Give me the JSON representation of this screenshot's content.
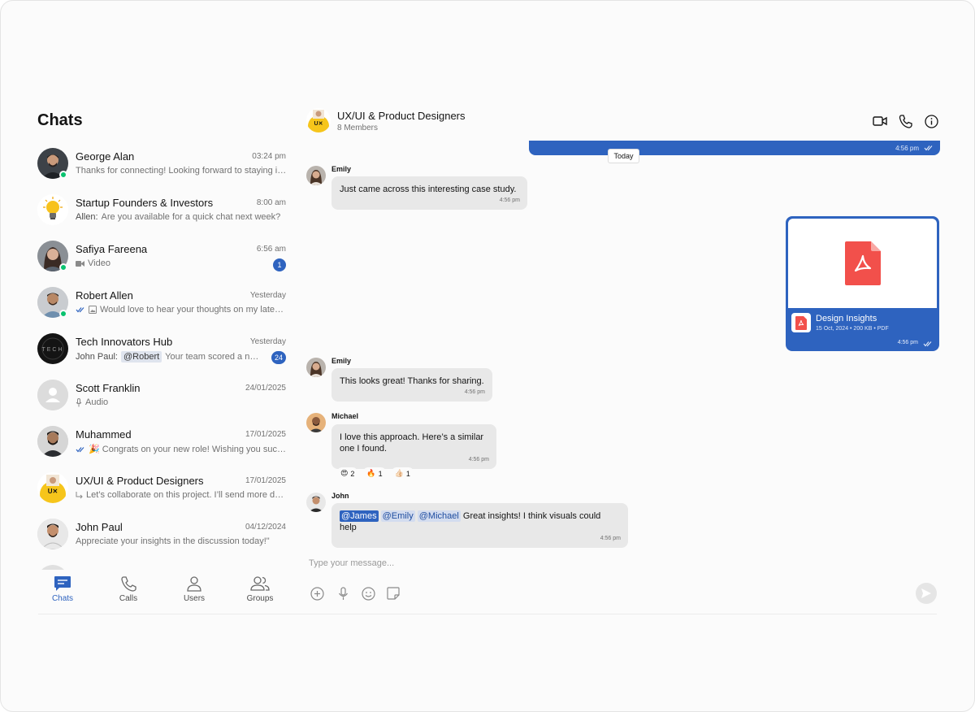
{
  "sidebar": {
    "title": "Chats",
    "chats": [
      {
        "name": "George Alan",
        "time": "03:24 pm",
        "sender": "",
        "preview": "Thanks for connecting! Looking forward to staying in touch.",
        "unread": "",
        "online": true
      },
      {
        "name": "Startup Founders & Investors",
        "time": "8:00 am",
        "sender": "Allen:",
        "preview": "Are you available for a quick chat next week?",
        "unread": "",
        "online": false
      },
      {
        "name": "Safiya Fareena",
        "time": "6:56 am",
        "sender": "",
        "preview": "Video",
        "unread": "1",
        "online": true
      },
      {
        "name": "Robert Allen",
        "time": "Yesterday",
        "sender": "",
        "preview": "Would love to hear your thoughts on my latest post",
        "unread": "",
        "online": true
      },
      {
        "name": "Tech Innovators Hub",
        "time": "Yesterday",
        "sender": "John Paul:",
        "mention": "@Robert",
        "preview": "Your team scored a new milestone",
        "unread": "24",
        "online": false
      },
      {
        "name": "Scott Franklin",
        "time": "24/01/2025",
        "sender": "",
        "preview": "Audio",
        "unread": "",
        "online": false
      },
      {
        "name": "Muhammed",
        "time": "17/01/2025",
        "sender": "",
        "preview": "🎉 Congrats on your new role! Wishing you success",
        "unread": "",
        "online": false
      },
      {
        "name": "UX/UI & Product Designers",
        "time": "17/01/2025",
        "sender": "",
        "preview": "Let’s collaborate on this project. I’ll send more details",
        "unread": "",
        "online": false
      },
      {
        "name": "John Paul",
        "time": "04/12/2024",
        "sender": "",
        "preview": "Appreciate your insights in the discussion today!\"",
        "unread": "",
        "online": false
      }
    ]
  },
  "nav": [
    {
      "label": "Chats",
      "icon": "chat-bubble-icon",
      "active": true
    },
    {
      "label": "Calls",
      "icon": "phone-icon",
      "active": false
    },
    {
      "label": "Users",
      "icon": "user-icon",
      "active": false
    },
    {
      "label": "Groups",
      "icon": "users-icon",
      "active": false
    }
  ],
  "conversation": {
    "name": "UX/UI & Product Designers",
    "members": "8 Members",
    "top_time": "4:56 pm",
    "date_separator": "Today",
    "messages": [
      {
        "sender": "Emily",
        "text": "Just came across this interesting case study.",
        "time": "4:56 pm"
      },
      {
        "sender": "Emily",
        "text": "This looks great! Thanks for sharing.",
        "time": "4:56 pm"
      },
      {
        "sender": "Michael",
        "text_line1": "I love this approach. Here’s a similar",
        "text_line2": "one I found.",
        "time": "4:56 pm"
      },
      {
        "sender": "John",
        "mentions": [
          "@James",
          "@Emily",
          "@Michael"
        ],
        "text": "Great insights! I think visuals could help",
        "time": "4:56 pm"
      }
    ],
    "reactions": [
      {
        "emoji": "😍",
        "count": "2"
      },
      {
        "emoji": "🔥",
        "count": "1"
      },
      {
        "emoji": "👍🏻",
        "count": "1"
      }
    ],
    "file": {
      "name": "Design Insights",
      "meta": "15 Oct, 2024 • 200 KB • PDF",
      "time": "4:56 pm"
    }
  },
  "composer": {
    "placeholder": "Type your message..."
  },
  "colors": {
    "accent": "#2e63bf",
    "online": "#09c26f",
    "pdf": "#f2504b",
    "bubble": "#e8e8e8"
  }
}
